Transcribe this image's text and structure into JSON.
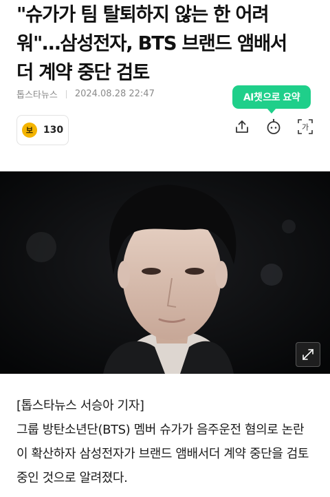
{
  "article": {
    "title": "\"슈가가 팀 탈퇴하지 않는 한 어려\n워\"…삼성전자, BTS 브랜드 앰배서\n더 계약 중단 검토",
    "source": "톱스타뉴스",
    "timestamp": "2024.08.28 22:47",
    "byline": "[톱스타뉴스 서승아 기자]",
    "paragraph": "그룹 방탄소년단(BTS) 멤버 슈가가 음주운전 혐의로 논란이 확산하자 삼성전자가 브랜드 앰배서더 계약 중단을 검토 중인 것으로 알려졌다."
  },
  "ai_summary": {
    "label_ai": "AI챗",
    "label_rest": "으로 요약"
  },
  "reaction": {
    "badge_text": "보",
    "count": "130"
  },
  "toolbar": {
    "icons": [
      "share-icon",
      "chatbot-icon",
      "font-size-icon"
    ],
    "font_size_glyph": "가"
  },
  "colors": {
    "accent": "#1fcf8a",
    "badge": "#f4b400"
  }
}
